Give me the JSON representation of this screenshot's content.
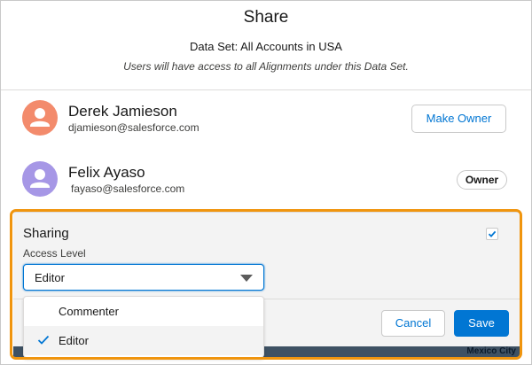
{
  "header": {
    "title": "Share",
    "dataset": "Data Set: All Accounts in USA",
    "subtitle": "Users will have access to all Alignments under this Data Set."
  },
  "people": [
    {
      "name": "Derek Jamieson",
      "email": "djamieson@salesforce.com",
      "action_label": "Make Owner",
      "avatar_color": "#f38b6c",
      "avatar_icon": "user-icon"
    },
    {
      "name": "Felix Ayaso",
      "email": "fayaso@salesforce.com",
      "badge_label": "Owner",
      "avatar_color": "#a697e6",
      "avatar_icon": "user-icon"
    }
  ],
  "sharing": {
    "label": "Sharing",
    "checked": true,
    "access_label": "Access Level",
    "selected": "Editor",
    "options": [
      {
        "label": "Commenter",
        "selected": false
      },
      {
        "label": "Editor",
        "selected": true
      }
    ]
  },
  "footer": {
    "cancel_label": "Cancel",
    "save_label": "Save"
  },
  "background": {
    "city_label": "Mexico City"
  },
  "colors": {
    "brand": "#0176d3",
    "highlight": "#f0950e"
  }
}
